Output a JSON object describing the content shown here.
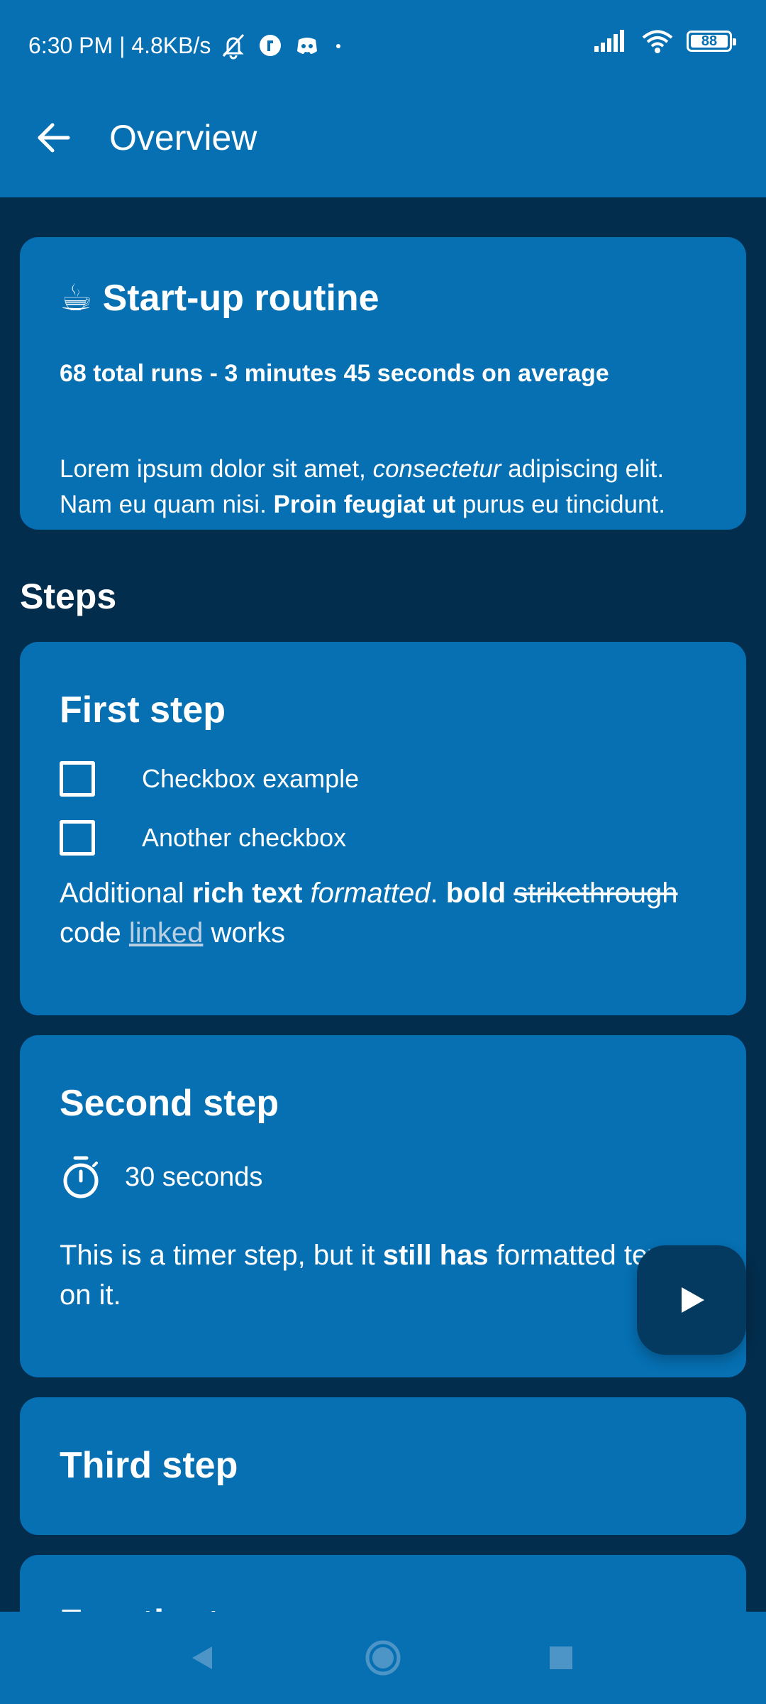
{
  "status_bar": {
    "time_speed": "6:30 PM | 4.8KB/s",
    "battery": "88",
    "icons": [
      "bell-off-icon",
      "app-notification-icon",
      "discord-icon",
      "dot-icon",
      "signal-icon",
      "wifi-icon",
      "battery-icon"
    ]
  },
  "app_bar": {
    "title": "Overview",
    "back_icon": "arrow-left-icon"
  },
  "summary": {
    "emoji": "☕",
    "title": "Start-up routine",
    "stats": "68 total runs - 3 minutes 45 seconds  on average",
    "description": {
      "part1": "Lorem ipsum dolor sit amet, ",
      "italic": "consectetur",
      "part2": " adipiscing elit. Nam eu quam nisi. ",
      "bold": "Proin feugiat ut",
      "part3": " purus eu tincidunt."
    }
  },
  "steps_heading": "Steps",
  "steps": [
    {
      "title": "First step",
      "checkboxes": [
        "Checkbox example",
        "Another checkbox"
      ],
      "rich": {
        "t1": "Additional ",
        "b1": "rich text",
        "t2": " ",
        "i1": "formatted",
        "t3": ". ",
        "b2": "bold",
        "t4": " ",
        "s1": "strikethrough",
        "t5": " code ",
        "link": "linked",
        "t6": " works"
      }
    },
    {
      "title": "Second step",
      "timer": "30 seconds",
      "rich": {
        "t1": "This is a timer step, but it ",
        "b1": "still has",
        "t2": " formatted text on it."
      }
    },
    {
      "title": "Third step"
    },
    {
      "title": "Fourth step"
    }
  ],
  "colors": {
    "primary": "#0670b3",
    "background": "#032d4c",
    "fab": "#043a5f",
    "link": "#b8cfe3"
  }
}
